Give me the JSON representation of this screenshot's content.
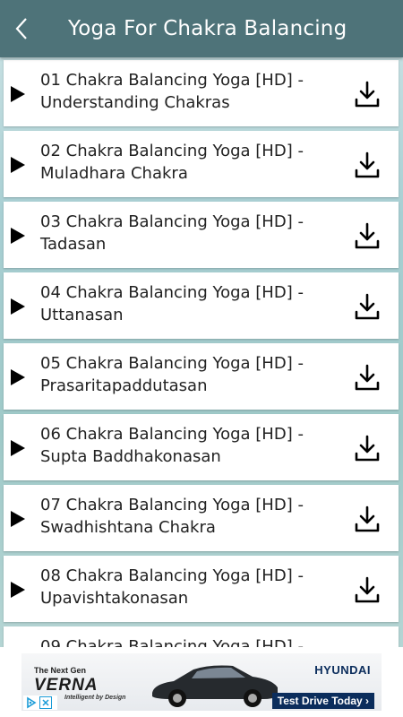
{
  "header": {
    "title": "Yoga For Chakra Balancing"
  },
  "videos": [
    {
      "line1": "01 Chakra Balancing Yoga [HD] -",
      "line2": "Understanding Chakras"
    },
    {
      "line1": "02 Chakra Balancing Yoga [HD] -",
      "line2": "Muladhara Chakra"
    },
    {
      "line1": "03 Chakra Balancing Yoga [HD] -",
      "line2": "Tadasan"
    },
    {
      "line1": "04 Chakra Balancing Yoga [HD] -",
      "line2": "Uttanasan"
    },
    {
      "line1": "05 Chakra Balancing Yoga [HD] -",
      "line2": "Prasaritapaddutasan"
    },
    {
      "line1": "06 Chakra Balancing Yoga [HD] -",
      "line2": "Supta Baddhakonasan"
    },
    {
      "line1": "07 Chakra Balancing Yoga [HD] -",
      "line2": "Swadhishtana Chakra"
    },
    {
      "line1": "08 Chakra Balancing Yoga [HD] -",
      "line2": "Upavishtakonasan"
    },
    {
      "line1": "09 Chakra Balancing Yoga [HD] -",
      "line2": ""
    }
  ],
  "ad": {
    "next_gen": "The Next Gen",
    "model": "VERNA",
    "tagline": "Intelligent by Design",
    "brand": "HYUNDAI",
    "cta": "Test Drive Today ›"
  },
  "colors": {
    "header_bg": "#4e7379",
    "icon": "#000000"
  }
}
